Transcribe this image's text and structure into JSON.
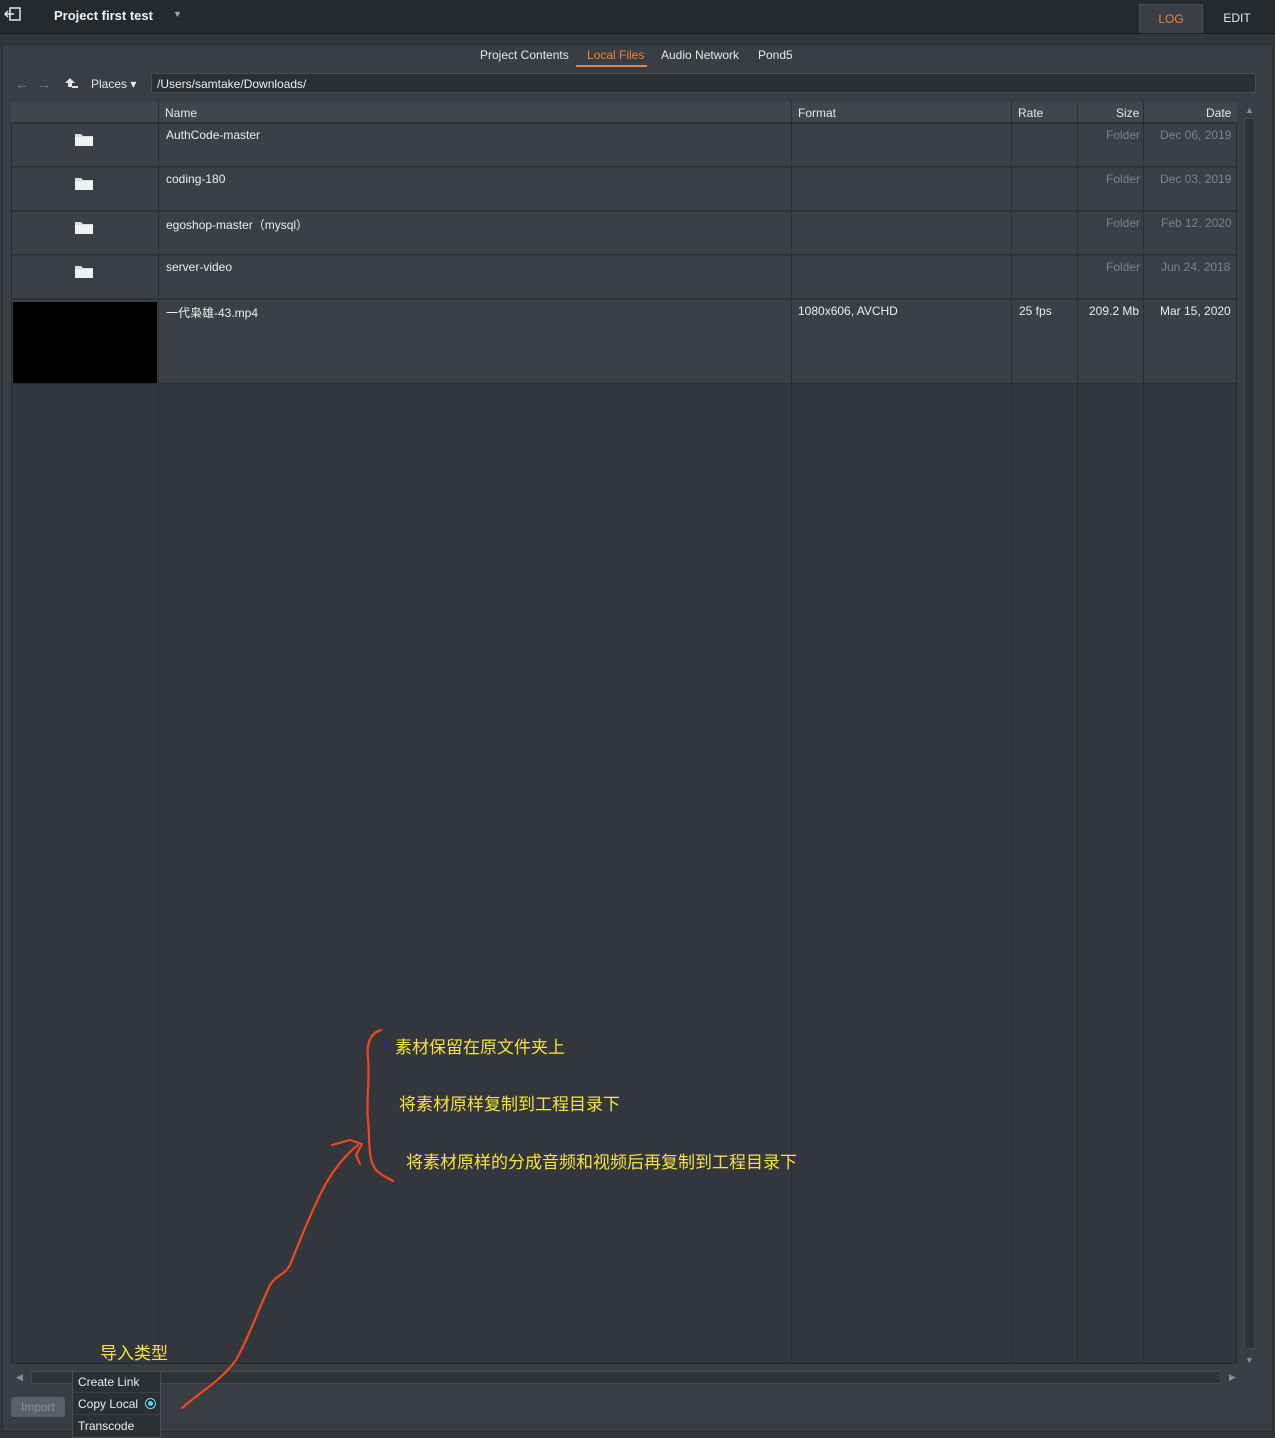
{
  "header": {
    "project_title": "Project first test",
    "modes": {
      "log": "LOG",
      "edit": "EDIT"
    }
  },
  "subtabs": [
    "Project Contents",
    "Local Files",
    "Audio Network",
    "Pond5"
  ],
  "nav": {
    "places_label": "Places ▾",
    "path": "/Users/samtake/Downloads/"
  },
  "table": {
    "columns": [
      "Name",
      "Format",
      "Rate",
      "Size",
      "Date"
    ],
    "rows": [
      {
        "name": "AuthCode-master",
        "format": "",
        "rate": "",
        "size": "Folder",
        "date": "Dec 06, 2019"
      },
      {
        "name": "coding-180",
        "format": "",
        "rate": "",
        "size": "Folder",
        "date": "Dec 03, 2019"
      },
      {
        "name": "egoshop-master（mysql）",
        "format": "",
        "rate": "",
        "size": "Folder",
        "date": "Feb 12, 2020"
      },
      {
        "name": "server-video",
        "format": "",
        "rate": "",
        "size": "Folder",
        "date": "Jun 24, 2018"
      },
      {
        "name": "一代枭雄-43.mp4",
        "format": "1080x606, AVCHD",
        "rate": "25 fps",
        "size": "209.2 Mb",
        "date": "Mar 15, 2020"
      }
    ]
  },
  "import": {
    "button": "Import",
    "menu": [
      "Create Link",
      "Copy Local",
      "Transcode"
    ],
    "selected": "Copy Local"
  },
  "annotations": {
    "import_type": "导入类型",
    "line1": "素材保留在原文件夹上",
    "line2": "将素材原样复制到工程目录下",
    "line3": "将素材原样的分成音频和视频后再复制到工程目录下",
    "stroke_color": "#f0481c",
    "text_color": "#f6e33b"
  },
  "colors": {
    "accent": "#f08234",
    "radio_selected": "#4fd3ff"
  }
}
